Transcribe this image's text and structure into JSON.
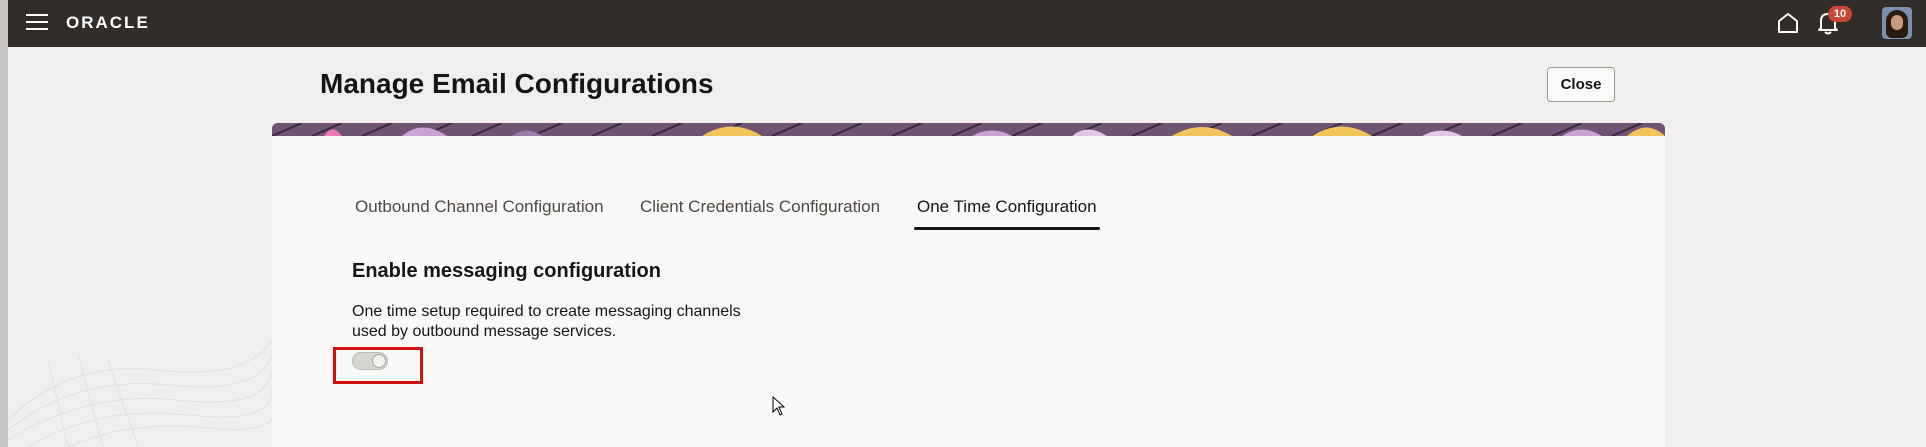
{
  "header": {
    "brand": "ORACLE",
    "notification_count": "10",
    "menu_icon": "hamburger-icon",
    "home_icon": "home-icon",
    "notifications_icon": "bell-icon"
  },
  "page": {
    "title": "Manage Email Configurations",
    "close_label": "Close"
  },
  "tabs": [
    {
      "label": "Outbound Channel Configuration",
      "active": false
    },
    {
      "label": "Client Credentials Configuration",
      "active": false
    },
    {
      "label": "One Time Configuration",
      "active": true
    }
  ],
  "section": {
    "heading": "Enable messaging configuration",
    "description_line1": "One time setup required to create messaging channels",
    "description_line2": "used by outbound message services.",
    "toggle_enabled": false
  },
  "colors": {
    "header_bg": "#312d2a",
    "badge": "#c74634",
    "highlight": "#d40f14"
  }
}
